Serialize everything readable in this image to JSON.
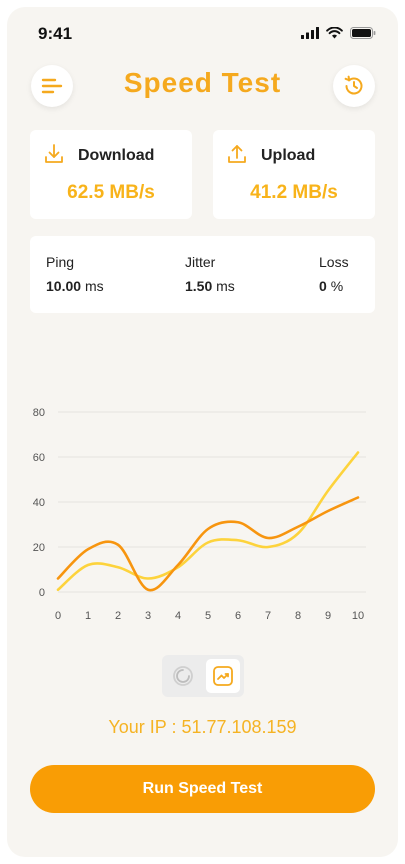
{
  "status_bar": {
    "time": "9:41"
  },
  "header": {
    "title": "Speed Test",
    "menu_icon": "menu-icon",
    "history_icon": "history-clock-icon"
  },
  "download": {
    "label": "Download",
    "value": "62.5 MB/s",
    "icon": "download-icon"
  },
  "upload": {
    "label": "Upload",
    "value": "41.2 MB/s",
    "icon": "upload-icon"
  },
  "metrics": {
    "ping": {
      "label": "Ping",
      "value": "10.00",
      "unit": "ms"
    },
    "jitter": {
      "label": "Jitter",
      "value": "1.50",
      "unit": "ms"
    },
    "loss": {
      "label": "Loss",
      "value": "0",
      "unit": "%"
    }
  },
  "toggle": {
    "gauge_icon": "gauge-icon",
    "chart_icon": "chart-trend-icon",
    "selected": "chart"
  },
  "ip_text": "Your IP : 51.77.108.159",
  "run_button": {
    "label": "Run Speed Test"
  },
  "colors": {
    "accent": "#f99d05",
    "accent_light": "#fdd33c",
    "title": "#f5a91e"
  },
  "chart_data": {
    "type": "line",
    "x": [
      0,
      1,
      2,
      3,
      4,
      5,
      6,
      7,
      8,
      9,
      10
    ],
    "x_ticks": [
      "0",
      "1",
      "2",
      "3",
      "4",
      "5",
      "6",
      "7",
      "8",
      "9",
      "10"
    ],
    "y_ticks": [
      "0",
      "20",
      "40",
      "60",
      "80"
    ],
    "ylim": [
      0,
      80
    ],
    "xlim": [
      0,
      10
    ],
    "grid": true,
    "series": [
      {
        "color": "#f7950f",
        "values": [
          6,
          19,
          21,
          1,
          12,
          28,
          31,
          24,
          29,
          36,
          42
        ]
      },
      {
        "color": "#fdd33c",
        "values": [
          1,
          12,
          11,
          6,
          11,
          22,
          23,
          20,
          26,
          45,
          62
        ]
      }
    ]
  }
}
